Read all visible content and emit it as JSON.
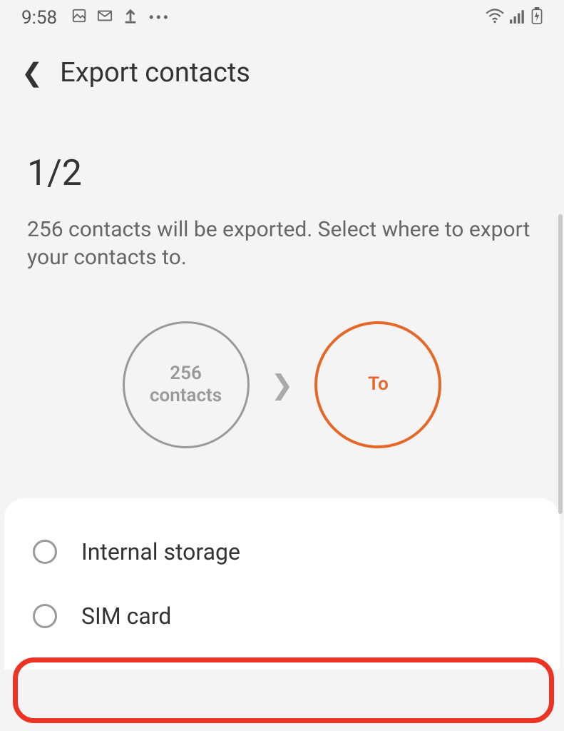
{
  "status": {
    "time": "9:58"
  },
  "header": {
    "title": "Export contacts"
  },
  "step": "1/2",
  "description": "256 contacts will be exported. Select where to export your contacts to.",
  "from_circle": {
    "line1": "256",
    "line2": "contacts"
  },
  "to_circle": "To",
  "options": [
    {
      "label": "Internal storage"
    },
    {
      "label": "SIM card"
    }
  ]
}
